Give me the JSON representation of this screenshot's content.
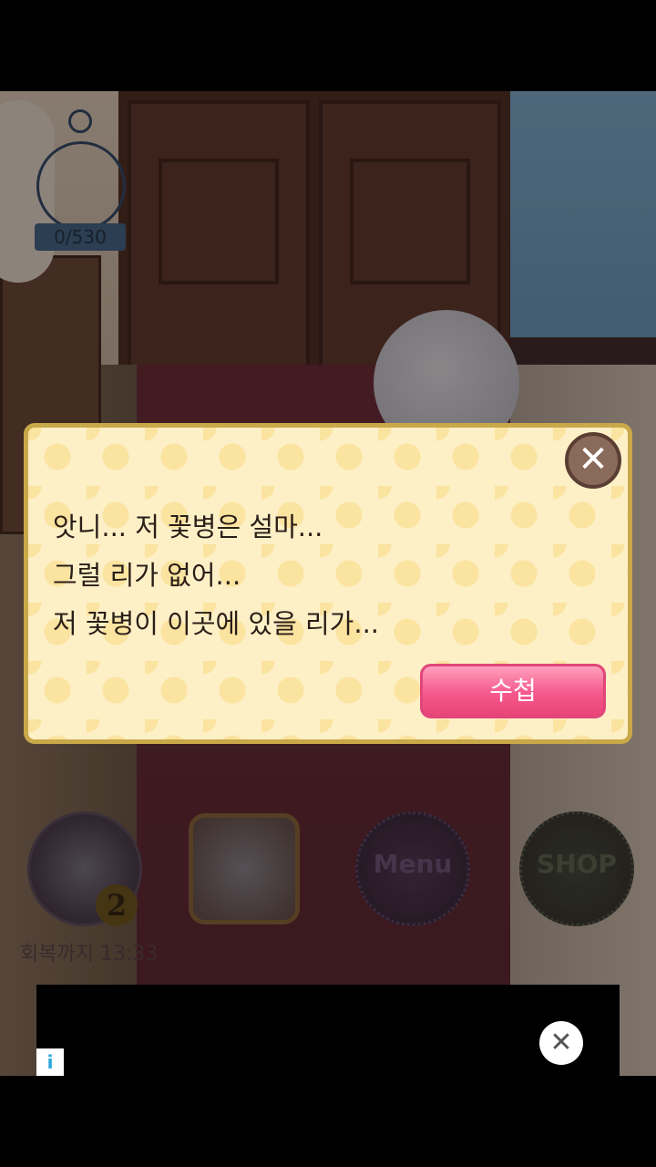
{
  "scene": {
    "counter_text": "0/530"
  },
  "dialog": {
    "lines": [
      "앗니... 저 꽃병은 설마...",
      "그럴 리가 없어...",
      "저 꽃병이 이곳에 있을 리가..."
    ],
    "ok_label": "수첩",
    "close_symbol": "✕"
  },
  "hud": {
    "tea_count": "2",
    "recover_text": "회복까지 13:33",
    "menu_label": "Menu",
    "shop_label": "SHOP"
  },
  "ad": {
    "info_symbol": "i",
    "close_symbol": "✕"
  },
  "icons": {
    "close": "close-icon",
    "teacup": "teacup-icon",
    "info": "info-icon"
  }
}
